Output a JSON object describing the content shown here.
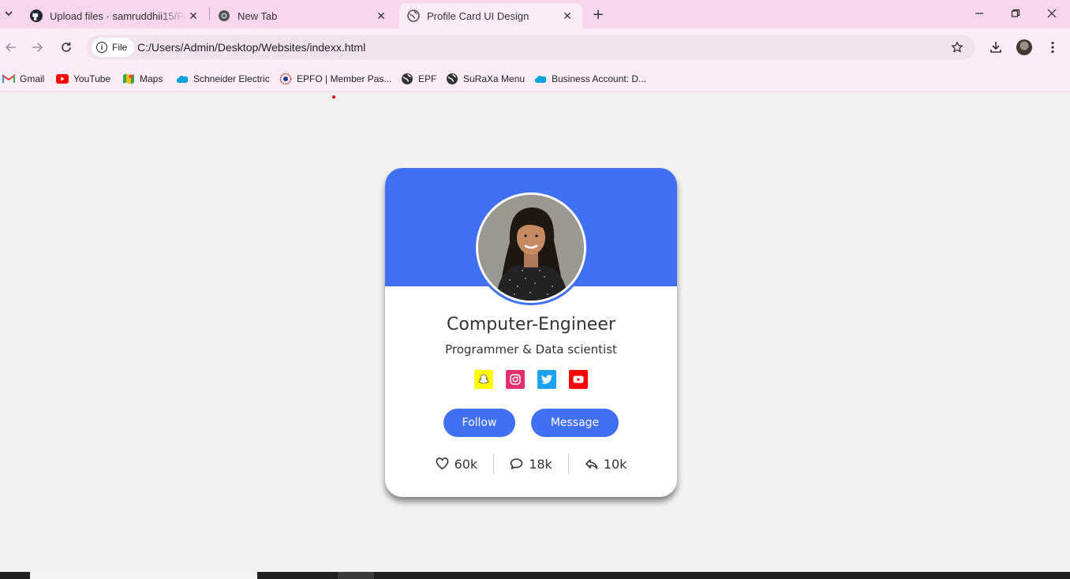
{
  "browser": {
    "tabs": [
      {
        "title": "Upload files · samruddhii15/Pro",
        "icon": "github-icon"
      },
      {
        "title": "New Tab",
        "icon": "chrome-icon"
      },
      {
        "title": "Profile Card UI Design",
        "icon": "globe-icon",
        "active": true
      }
    ],
    "address": {
      "chip": "File",
      "url": "C:/Users/Admin/Desktop/Websites/indexx.html"
    },
    "bookmarks": [
      {
        "label": "Gmail",
        "icon": "gmail-icon"
      },
      {
        "label": "YouTube",
        "icon": "youtube-icon"
      },
      {
        "label": "Maps",
        "icon": "maps-icon"
      },
      {
        "label": "Schneider Electric",
        "icon": "salesforce-cloud-icon"
      },
      {
        "label": "EPFO | Member Pas...",
        "icon": "epfo-icon"
      },
      {
        "label": "EPF",
        "icon": "globe-icon"
      },
      {
        "label": "SuRaXa Menu",
        "icon": "globe-icon"
      },
      {
        "label": "Business Account: D...",
        "icon": "salesforce-cloud-icon"
      }
    ]
  },
  "profile": {
    "name": "Computer-Engineer",
    "job": "Programmer & Data scientist",
    "socials": [
      {
        "icon": "snapchat-icon",
        "color": "#fffc00"
      },
      {
        "icon": "instagram-icon",
        "color": "#e1306c"
      },
      {
        "icon": "twitter-icon",
        "color": "#1da1f2"
      },
      {
        "icon": "youtube-icon",
        "color": "#ff0000"
      }
    ],
    "buttons": {
      "follow": "Follow",
      "message": "Message"
    },
    "stats": {
      "likes": "60k",
      "comments": "18k",
      "shares": "10k"
    },
    "accent": "#4070f4"
  }
}
